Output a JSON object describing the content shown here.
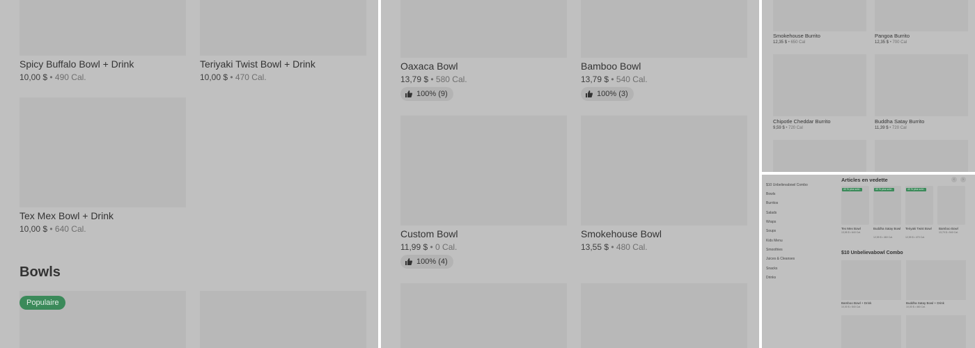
{
  "panel1": {
    "items_top": [
      {
        "name": "Spicy Buffalo Bowl + Drink",
        "price": "10,00 $",
        "cal": "490 Cal."
      },
      {
        "name": "Teriyaki Twist Bowl + Drink",
        "price": "10,00 $",
        "cal": "470 Cal."
      }
    ],
    "item_mid": {
      "name": "Tex Mex Bowl + Drink",
      "price": "10,00 $",
      "cal": "640 Cal."
    },
    "section_title": "Bowls",
    "popular_badge": "Populaire"
  },
  "panel2": {
    "items": [
      {
        "name": "Oaxaca Bowl",
        "price": "13,79 $",
        "cal": "580 Cal.",
        "rating": "100% (9)"
      },
      {
        "name": "Bamboo Bowl",
        "price": "13,79 $",
        "cal": "540 Cal.",
        "rating": "100% (3)"
      },
      {
        "name": "Custom Bowl",
        "price": "11,99 $",
        "cal": "0 Cal.",
        "rating": "100% (4)"
      },
      {
        "name": "Smokehouse Bowl",
        "price": "13,55 $",
        "cal": "480 Cal."
      }
    ]
  },
  "panel3": {
    "items": [
      {
        "name": "Smokehouse Burrito",
        "price": "12,35 $",
        "cal": "650 Cal"
      },
      {
        "name": "Pangoa Burrito",
        "price": "12,35 $",
        "cal": "700 Cal"
      },
      {
        "name": "Chipotle Cheddar Burrito",
        "price": "9,59 $",
        "cal": "720 Cal"
      },
      {
        "name": "Buddha Satay Burrito",
        "price": "11,39 $",
        "cal": "720 Cal"
      }
    ]
  },
  "panel4": {
    "nav": [
      "$10 Unbelievabowl Combo",
      "Bowls",
      "Burritos",
      "Salads",
      "Wraps",
      "Soups",
      "Kids Menu",
      "Smoothies",
      "Juices & Cleanses",
      "Snacks",
      "Drinks"
    ],
    "featured_title": "Articles en vedette",
    "featured": [
      {
        "badge": "40 % plus sold..",
        "name": "Tex Mex Bowl",
        "price": "13,55 $",
        "cal": "640 Cal."
      },
      {
        "badge": "40 % plus sold..",
        "name": "Buddha Satay Bowl",
        "price": "12,59 $",
        "cal": "460 Cal."
      },
      {
        "badge": "40 % plus sold..",
        "name": "Teriyaki Twist Bowl",
        "price": "12,59 $",
        "cal": "470 Cal."
      },
      {
        "badge": "40 % plus sold..",
        "name": "Bamboo Bowl",
        "price": "13,79 $",
        "cal": "540 Cal."
      }
    ],
    "combo_title": "$10 Unbelievabowl Combo",
    "combo_items": [
      {
        "name": "Bamboo Bowl + Drink",
        "price": "10,00 $",
        "cal": "540 Cal."
      },
      {
        "name": "Buddha Satay Bowl + Drink",
        "price": "10,00 $",
        "cal": "460 Cal."
      }
    ]
  },
  "colors": {
    "overlay": "#c0c0c0",
    "placeholder": "#b8b8b8",
    "badge_green": "#3b8a5a"
  },
  "icons": [
    "thumbs-up-icon",
    "chevron-left-icon",
    "chevron-right-icon"
  ]
}
